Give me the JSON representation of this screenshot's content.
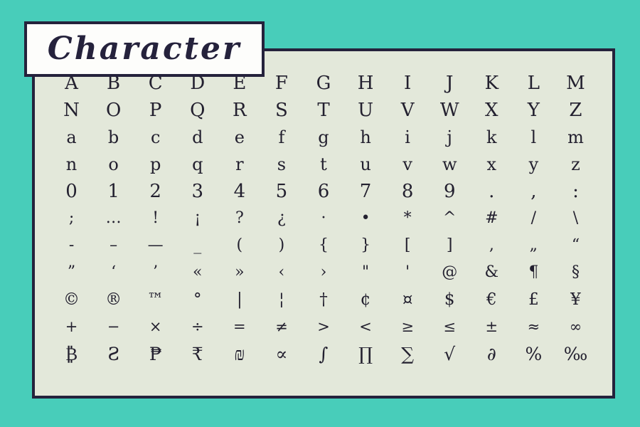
{
  "poster": {
    "title": "Character",
    "background_color": "#48cdba",
    "panel_color": "#e3e8da",
    "ink_color": "#25223c",
    "plate_color": "#fdfdfb"
  },
  "specimen": {
    "columns": 13,
    "rows": [
      {
        "name": "uppercase-a-m",
        "kind": "upper",
        "glyphs": [
          "A",
          "B",
          "C",
          "D",
          "E",
          "F",
          "G",
          "H",
          "I",
          "J",
          "K",
          "L",
          "M"
        ]
      },
      {
        "name": "uppercase-n-z",
        "kind": "upper",
        "glyphs": [
          "N",
          "O",
          "P",
          "Q",
          "R",
          "S",
          "T",
          "U",
          "V",
          "W",
          "X",
          "Y",
          "Z"
        ]
      },
      {
        "name": "lowercase-a-m",
        "kind": "lower",
        "glyphs": [
          "a",
          "b",
          "c",
          "d",
          "e",
          "f",
          "g",
          "h",
          "i",
          "j",
          "k",
          "l",
          "m"
        ]
      },
      {
        "name": "lowercase-n-z",
        "kind": "lower",
        "glyphs": [
          "n",
          "o",
          "p",
          "q",
          "r",
          "s",
          "t",
          "u",
          "v",
          "w",
          "x",
          "y",
          "z"
        ]
      },
      {
        "name": "digits-and-stops",
        "kind": "digit",
        "glyphs": [
          "0",
          "1",
          "2",
          "3",
          "4",
          "5",
          "6",
          "7",
          "8",
          "9",
          ".",
          ",",
          ":"
        ]
      },
      {
        "name": "punctuation-marks",
        "kind": "punct",
        "glyphs": [
          ";",
          "…",
          "!",
          "¡",
          "?",
          "¿",
          "·",
          "•",
          "*",
          "^",
          "#",
          "/",
          "\\"
        ]
      },
      {
        "name": "dashes-and-brackets",
        "kind": "punct",
        "glyphs": [
          "-",
          "–",
          "—",
          "_",
          "(",
          ")",
          "{",
          "}",
          "[",
          "]",
          "‚",
          "„",
          "“"
        ]
      },
      {
        "name": "quotes-and-marks",
        "kind": "punct",
        "glyphs": [
          "”",
          "‘",
          "’",
          "«",
          "»",
          "‹",
          "›",
          "\"",
          "'",
          "@",
          "&",
          "¶",
          "§"
        ]
      },
      {
        "name": "legal-and-currency",
        "kind": "symbol",
        "glyphs": [
          "©",
          "®",
          "™",
          "°",
          "|",
          "¦",
          "†",
          "¢",
          "¤",
          "$",
          "€",
          "£",
          "¥"
        ]
      },
      {
        "name": "math-operators",
        "kind": "math",
        "glyphs": [
          "+",
          "−",
          "×",
          "÷",
          "=",
          "≠",
          ">",
          "<",
          "≥",
          "≤",
          "±",
          "≈",
          "∞"
        ]
      },
      {
        "name": "extended-symbols",
        "kind": "special",
        "glyphs": [
          "₿",
          "Ƨ",
          "₱",
          "₹",
          "₪",
          "∝",
          "∫",
          "∏",
          "∑",
          "√",
          "∂",
          "%",
          "‰"
        ]
      }
    ]
  }
}
